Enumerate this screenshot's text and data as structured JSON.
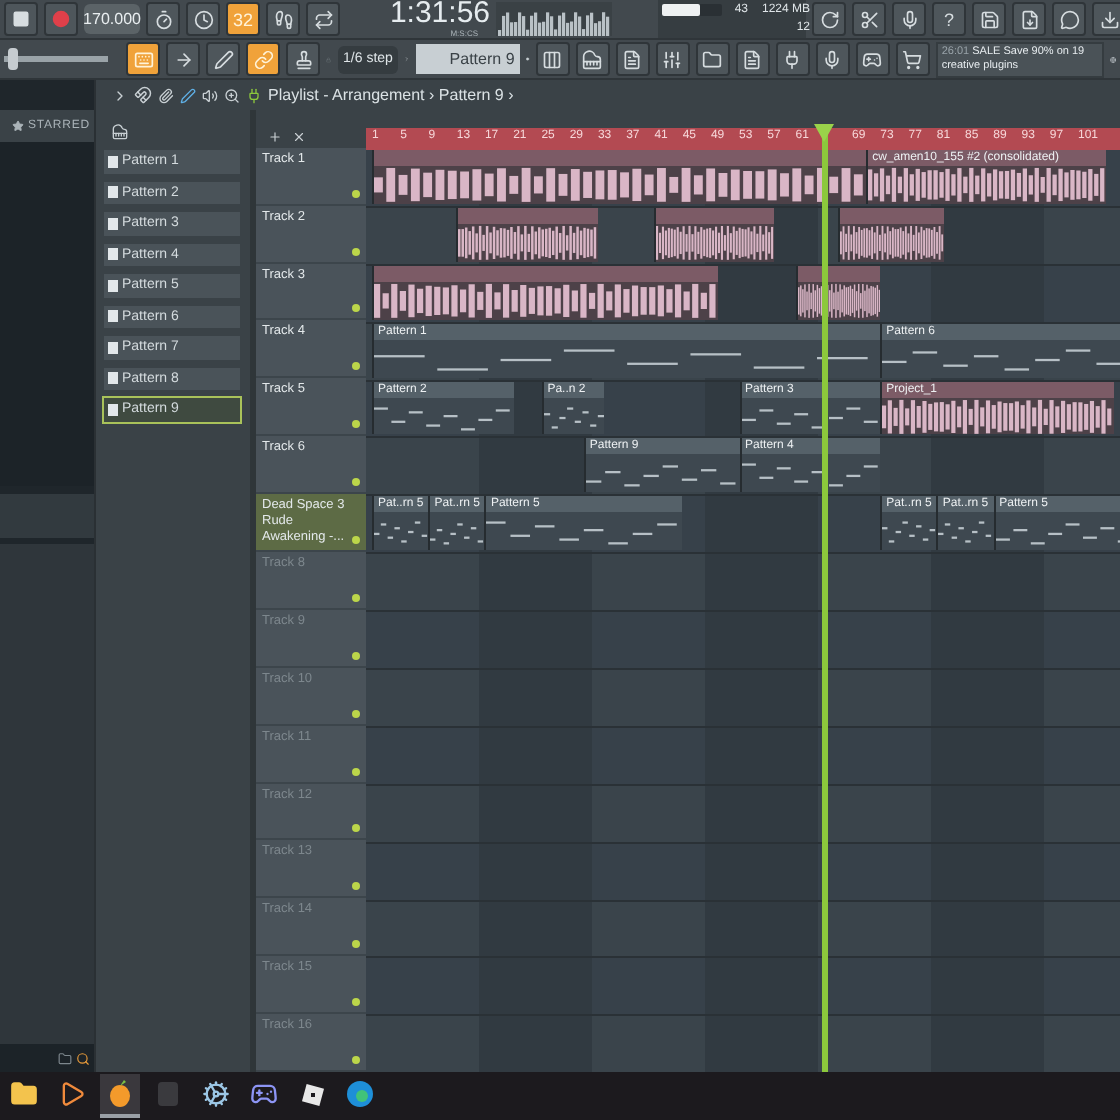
{
  "toolbar": {
    "tempo": "170.000",
    "volume": {
      "level": 0.04
    },
    "cpu_meter": {
      "level": 0.62
    },
    "countdown": "32",
    "time": "1:31:56",
    "time_unit": "M:S:CS",
    "cpu": "43",
    "memory": "1224 MB",
    "polyphony": "12",
    "help": "?",
    "snap": "1/6 step",
    "pattern": "Pattern 9",
    "news_time": "26:01",
    "news": "SALE Save 90% on 19 creative plugins",
    "top_buttons": [
      {
        "kind": "metronome",
        "on": false
      },
      {
        "kind": "wait",
        "on": false
      },
      {
        "kind": "countdown",
        "on": true
      },
      {
        "kind": "step",
        "on": false
      },
      {
        "kind": "loop",
        "on": false
      }
    ],
    "edit_buttons": [
      {
        "kind": "typing",
        "on": true
      },
      {
        "kind": "arrow",
        "on": false
      },
      {
        "kind": "pen",
        "on": false
      },
      {
        "kind": "link",
        "on": true
      },
      {
        "kind": "stamp",
        "on": false
      }
    ]
  },
  "browser": {
    "title": "STARRED"
  },
  "playlist": {
    "title": "Playlist - Arrangement",
    "separator": "›",
    "pattern": "Pattern 9",
    "end": "›"
  },
  "patterns": [
    {
      "label": "Pattern 1",
      "selected": false
    },
    {
      "label": "Pattern 2",
      "selected": false
    },
    {
      "label": "Pattern 3",
      "selected": false
    },
    {
      "label": "Pattern 4",
      "selected": false
    },
    {
      "label": "Pattern 5",
      "selected": false
    },
    {
      "label": "Pattern 6",
      "selected": false
    },
    {
      "label": "Pattern 7",
      "selected": false
    },
    {
      "label": "Pattern 8",
      "selected": false
    },
    {
      "label": "Pattern 9",
      "selected": true
    }
  ],
  "ruler": [
    "1",
    "5",
    "9",
    "13",
    "17",
    "21",
    "25",
    "29",
    "33",
    "37",
    "41",
    "45",
    "49",
    "53",
    "57",
    "61",
    "69",
    "73",
    "77",
    "81",
    "85",
    "89",
    "93",
    "97",
    "101"
  ],
  "tracks": [
    {
      "name": "Track 1",
      "selected": false,
      "clips": [
        {
          "kind": "audio"
        },
        {
          "kind": "audio",
          "label": "cw_amen10_155 #2 (consolidated)"
        }
      ]
    },
    {
      "name": "Track 2",
      "selected": false,
      "clips": [
        {
          "kind": "audio"
        },
        {
          "kind": "audio"
        },
        {
          "kind": "audio"
        }
      ]
    },
    {
      "name": "Track 3",
      "selected": false,
      "clips": [
        {
          "kind": "audio"
        },
        {
          "kind": "audio"
        }
      ]
    },
    {
      "name": "Track 4",
      "selected": false,
      "clips": [
        {
          "kind": "pattern",
          "label": "Pattern 1"
        },
        {
          "kind": "pattern",
          "label": "Pattern 6"
        }
      ]
    },
    {
      "name": "Track 5",
      "selected": false,
      "clips": [
        {
          "kind": "pattern",
          "label": "Pattern 2"
        },
        {
          "kind": "pattern",
          "label": "Pa..n 2"
        },
        {
          "kind": "pattern",
          "label": "Pattern 3"
        },
        {
          "kind": "audio",
          "label": "Project_1"
        }
      ]
    },
    {
      "name": "Track 6",
      "selected": false,
      "clips": [
        {
          "kind": "pattern",
          "label": "Pattern 9"
        },
        {
          "kind": "pattern",
          "label": "Pattern 4"
        }
      ]
    },
    {
      "name": "Dead Space 3 Rude Awakening -...",
      "selected": true,
      "clips": [
        {
          "kind": "pattern",
          "label": "Pat..rn 5"
        },
        {
          "kind": "pattern",
          "label": "Pat..rn 5"
        },
        {
          "kind": "pattern",
          "label": "Pattern 5"
        },
        {
          "kind": "pattern",
          "label": "Pat..rn 5"
        },
        {
          "kind": "pattern",
          "label": "Pat..rn 5"
        },
        {
          "kind": "pattern",
          "label": "Pattern 5"
        }
      ]
    },
    {
      "name": "Track 8",
      "selected": false
    },
    {
      "name": "Track 9",
      "selected": false
    },
    {
      "name": "Track 10",
      "selected": false
    },
    {
      "name": "Track 11",
      "selected": false
    },
    {
      "name": "Track 12",
      "selected": false
    },
    {
      "name": "Track 13",
      "selected": false
    },
    {
      "name": "Track 14",
      "selected": false
    },
    {
      "name": "Track 15",
      "selected": false
    },
    {
      "name": "Track 16",
      "selected": false
    }
  ],
  "taskbar": [
    {
      "kind": "folder",
      "active": false
    },
    {
      "kind": "media",
      "active": false
    },
    {
      "kind": "fruit",
      "active": true
    },
    {
      "kind": "dim",
      "active": false
    },
    {
      "kind": "steam",
      "active": false
    },
    {
      "kind": "discord",
      "active": false
    },
    {
      "kind": "roblox",
      "active": false
    },
    {
      "kind": "edge",
      "active": false
    }
  ]
}
